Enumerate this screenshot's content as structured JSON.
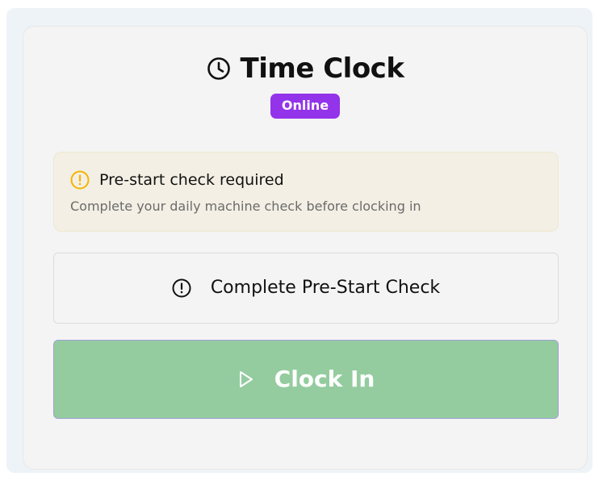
{
  "header": {
    "title": "Time Clock",
    "icon": "clock-icon"
  },
  "status": {
    "label": "Online",
    "color": "#9333ea"
  },
  "alert": {
    "icon": "warning-circle-icon",
    "icon_color": "#f5b400",
    "title": "Pre-start check required",
    "description": "Complete your daily machine check before clocking in"
  },
  "actions": {
    "pre_start": {
      "label": "Complete Pre-Start Check",
      "icon": "alert-circle-icon"
    },
    "clock_in": {
      "label": "Clock In",
      "icon": "play-icon",
      "color": "#94cc9f"
    }
  }
}
